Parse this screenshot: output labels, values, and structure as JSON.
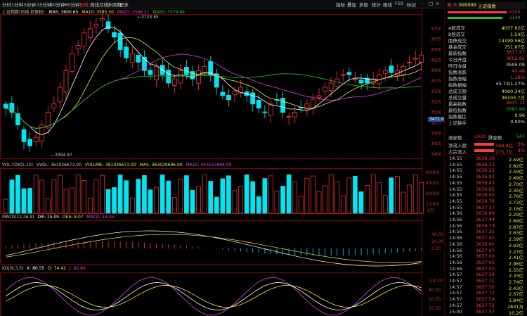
{
  "toolbar": {
    "items": [
      {
        "label": "分时"
      },
      {
        "label": "1分钟"
      },
      {
        "label": "5分钟"
      },
      {
        "label": "15分钟"
      },
      {
        "label": "30分钟"
      },
      {
        "label": "60分钟"
      },
      {
        "label": "日线",
        "active": true
      },
      {
        "label": "周线"
      },
      {
        "label": "月线"
      },
      {
        "label": "多周期"
      },
      {
        "label": "更多"
      }
    ],
    "right_items": [
      {
        "label": "指标"
      },
      {
        "label": "叠加"
      },
      {
        "label": "多股"
      },
      {
        "label": "统计"
      },
      {
        "label": "画线"
      },
      {
        "label": "F10"
      },
      {
        "label": "标记"
      },
      {
        "label": "-"
      },
      {
        "label": "□"
      },
      {
        "label": "×"
      }
    ]
  },
  "main_panel": {
    "title": "上证指数(日线,前复权)",
    "ma5": "MA5: 3600.65",
    "ma10": "MA10: 3585.50",
    "ma20": "MA20: 3568.21",
    "ma60": "MA60: 3579.84",
    "high_marker": "3723.85",
    "low_marker": "3394.97",
    "price_tag": "3471.0",
    "y_ticks": [
      "3700",
      "3675",
      "3650",
      "3625",
      "3600",
      "3575",
      "3550",
      "3525",
      "3500",
      "3475",
      "3450",
      "3425",
      "3400"
    ]
  },
  "vol_panel": {
    "title": "VOL-TDX(5,10)",
    "vvol": "VVOL: 361036672.00",
    "volume": "VOLUME: 361036672.00",
    "ma5": "MA5: 363029696.00",
    "ma10": "MA10: 353537888.00",
    "y_ticks": [
      "60000",
      "45000",
      "30000",
      "15000"
    ],
    "unit": "X万"
  },
  "macd_panel": {
    "title": "MACD(12,26,9)",
    "dif": "DIF: 15.09",
    "dea": "DEA: 8.07",
    "macd": "MACD: 14.05",
    "y_ticks": [
      "40.00",
      "20.00",
      "0.00"
    ]
  },
  "kdj_panel": {
    "title": "KDJ(9,3,3)",
    "k": "K: 80.55",
    "d": "D: 74.42",
    "j": "J: 92.80",
    "y_ticks": [
      "100.00",
      "80.00",
      "50.00",
      "20.00"
    ]
  },
  "right_panel": {
    "code": "999999",
    "name": "上证指数",
    "bar1_value": "1250",
    "bar2_value": "1140",
    "stats": [
      {
        "k": "A股成交",
        "v": "4057.62亿",
        "c": "yellow"
      },
      {
        "k": "B股成交",
        "v": "1.54亿",
        "c": "yellow"
      },
      {
        "k": "国债成交",
        "v": "14199.56亿",
        "c": "yellow"
      },
      {
        "k": "基金成交",
        "v": "751.87亿",
        "c": "yellow"
      },
      {
        "k": "最新指数",
        "v": "3637.57",
        "c": "red"
      },
      {
        "k": "今日开盘",
        "v": "3602.82",
        "c": "red"
      },
      {
        "k": "昨日收盘",
        "v": "3595.09",
        "c": "white"
      },
      {
        "k": "指数涨跌",
        "v": "42.48",
        "c": "red"
      },
      {
        "k": "指数涨幅",
        "v": "1.18%",
        "c": "red"
      },
      {
        "k": "指数振幅",
        "v": "45.73/1.27%",
        "c": "white"
      },
      {
        "k": "总成交额",
        "v": "4060.34亿",
        "c": "yellow"
      },
      {
        "k": "总成交量",
        "v": "36103.7万",
        "c": "yellow"
      },
      {
        "k": "最高指数",
        "v": "3637.72",
        "c": "red"
      },
      {
        "k": "最低指数",
        "v": "3591.99",
        "c": "green"
      },
      {
        "k": "指数量比",
        "v": "0.96",
        "c": "yellow"
      },
      {
        "k": "上证换手",
        "v": "0.90%",
        "c": "white"
      }
    ],
    "up_label": "涨家数",
    "up_count": "1420",
    "down_label": "跌家数",
    "down_count": "547",
    "net_inflow_label": "净流入额",
    "net_inflow": "168.8亿",
    "net_inflow_pct": "3%",
    "big_inflow_label": "大宗流入",
    "big_inflow": "175.7亿",
    "big_inflow_pct": "4%",
    "ticks": [
      {
        "t": "14:55",
        "p": "3636.10",
        "v": "2.59亿"
      },
      {
        "t": "14:55",
        "p": "3636.23",
        "v": "2.82亿"
      },
      {
        "t": "14:55",
        "p": "3636.22",
        "v": "2.59亿"
      },
      {
        "t": "14:55",
        "p": "3636.93",
        "v": "2.49亿"
      },
      {
        "t": "14:55",
        "p": "3636.43",
        "v": "2.70亿"
      },
      {
        "t": "14:55",
        "p": "3636.65",
        "v": "2.35亿"
      },
      {
        "t": "14:55",
        "p": "3636.90",
        "v": "2.76亿"
      },
      {
        "t": "14:55",
        "p": "3636.76",
        "v": "2.72亿"
      },
      {
        "t": "14:55",
        "p": "3637.37",
        "v": "2.18亿"
      },
      {
        "t": "14:56",
        "p": "3636.89",
        "v": "2.29亿"
      },
      {
        "t": "14:56",
        "p": "3637.44",
        "v": "2.84亿"
      },
      {
        "t": "14:56",
        "p": "3636.73",
        "v": "2.87亿"
      },
      {
        "t": "14:56",
        "p": "3637.25",
        "v": "2.63亿"
      },
      {
        "t": "14:56",
        "p": "3637.41",
        "v": "2.59亿"
      },
      {
        "t": "14:56",
        "p": "3636.92",
        "v": "2.93亿"
      },
      {
        "t": "14:56",
        "p": "3637.07",
        "v": "2.27亿"
      },
      {
        "t": "14:56",
        "p": "3637.00",
        "v": "2.41亿"
      },
      {
        "t": "14:56",
        "p": "3637.05",
        "v": "2.96亿"
      },
      {
        "t": "14:56",
        "p": "3637.00",
        "v": "2.55亿"
      },
      {
        "t": "14:57",
        "p": "3637.39",
        "v": "2.33亿"
      },
      {
        "t": "14:57",
        "p": "3637.71",
        "v": "2.74亿"
      },
      {
        "t": "14:57",
        "p": "3637.50",
        "v": "2.43亿"
      },
      {
        "t": "14:57",
        "p": "3637.72",
        "v": "2.57亿"
      },
      {
        "t": "14:57",
        "p": "3637.54",
        "v": "1.84亿"
      },
      {
        "t": "14:57",
        "p": "3637.72",
        "v": "2831万"
      },
      {
        "t": "15:00",
        "p": "3637.57",
        "v": "10.2亿"
      }
    ]
  },
  "colors": {
    "up": "#ff3b3b",
    "down": "#00e5f0",
    "ma5": "#ffffff",
    "ma10": "#e8e84a",
    "ma20": "#e040e0",
    "ma60": "#21c521",
    "grid": "#5a0000",
    "frame": "#8a0000"
  }
}
